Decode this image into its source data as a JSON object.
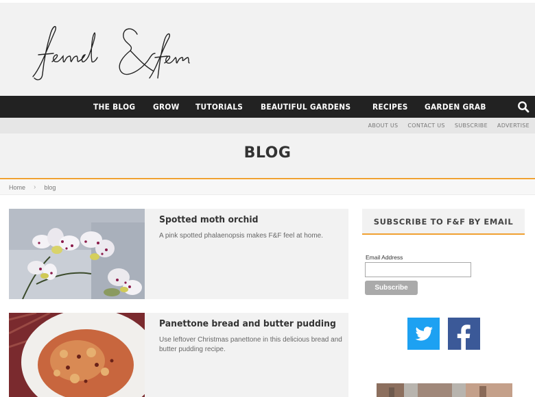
{
  "logo": {
    "text": "fennel & fern"
  },
  "nav": {
    "items": [
      "THE BLOG",
      "GROW",
      "TUTORIALS",
      "BEAUTIFUL GARDENS",
      "RECIPES",
      "GARDEN GRAB"
    ],
    "search_icon": "search-icon"
  },
  "subnav": {
    "items": [
      "ABOUT US",
      "CONTACT US",
      "SUBSCRIBE",
      "ADVERTISE"
    ]
  },
  "page": {
    "title": "BLOG"
  },
  "breadcrumb": {
    "home": "Home",
    "current": "blog"
  },
  "posts": [
    {
      "title": "Spotted moth orchid",
      "excerpt": "A pink spotted phalaenopsis makes F&F feel at home."
    },
    {
      "title": "Panettone bread and butter pudding",
      "excerpt": "Use leftover Christmas panettone in this delicious bread and butter pudding recipe."
    }
  ],
  "sidebar": {
    "subscribe_title": "SUBSCRIBE TO F&F BY EMAIL",
    "email_label": "Email Address",
    "email_placeholder": "",
    "subscribe_button": "Subscribe",
    "social": [
      {
        "icon": "twitter-icon",
        "color": "#1da1f2"
      },
      {
        "icon": "facebook-icon",
        "color": "#3b5998"
      }
    ]
  },
  "colors": {
    "accent": "#f0a030",
    "nav_bg": "#222222",
    "panel_bg": "#f2f2f2"
  }
}
